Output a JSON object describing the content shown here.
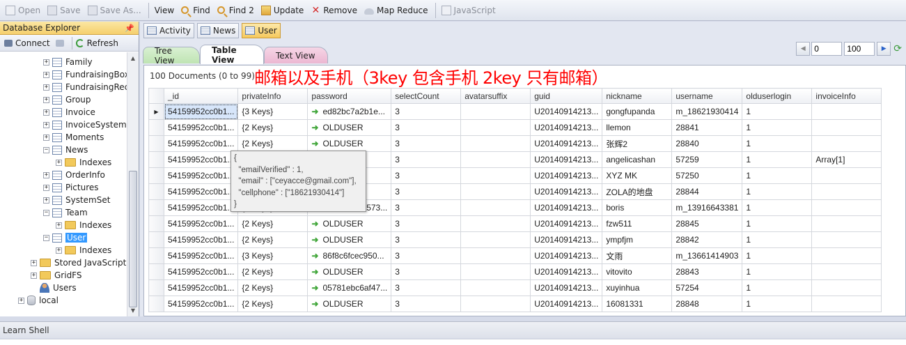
{
  "toolbar": {
    "open": "Open",
    "save": "Save",
    "save_as": "Save As...",
    "view": "View",
    "find": "Find",
    "find2": "Find 2",
    "update": "Update",
    "remove": "Remove",
    "map_reduce": "Map Reduce",
    "javascript": "JavaScript"
  },
  "explorer": {
    "title": "Database Explorer",
    "pin_icon": "pin-icon",
    "connect": "Connect",
    "refresh": "Refresh",
    "tree": [
      "Family",
      "FundraisingBox",
      "FundraisingRec",
      "Group",
      "Invoice",
      "InvoiceSystemS",
      "Moments",
      "News",
      "Indexes",
      "OrderInfo",
      "Pictures",
      "SystemSet",
      "Team",
      "Indexes",
      "User",
      "Indexes",
      "Stored JavaScript",
      "GridFS",
      "Users",
      "local"
    ]
  },
  "collection_tabs": [
    "Activity",
    "News",
    "User"
  ],
  "view_tabs": {
    "tree": "Tree View",
    "table": "Table View",
    "text": "Text View"
  },
  "pager": {
    "start": "0",
    "limit": "100"
  },
  "doc_count": "100 Documents (0 to 99)",
  "overlay_note": "邮箱以及手机（3key 包含手机 2key 只有邮箱）",
  "grid": {
    "columns": [
      "_id",
      "privateInfo",
      "password",
      "selectCount",
      "avatarsuffix",
      "guid",
      "nickname",
      "username",
      "olduserlogin",
      "invoiceInfo"
    ],
    "rows": [
      [
        "54159952cc0b1...",
        "{3 Keys}",
        "ed82bc7a2b1e...",
        "3",
        "",
        "U20140914213...",
        "gongfupanda",
        "m_18621930414",
        "1",
        ""
      ],
      [
        "54159952cc0b1...",
        "{2 Keys}",
        "OLDUSER",
        "3",
        "",
        "U20140914213...",
        "llemon",
        "28841",
        "1",
        ""
      ],
      [
        "54159952cc0b1...",
        "{2 Keys}",
        "OLDUSER",
        "3",
        "",
        "U20140914213...",
        "张辉2",
        "28840",
        "1",
        ""
      ],
      [
        "54159952cc0b1...",
        "{2 Keys}",
        "OLDUSER",
        "3",
        "",
        "U20140914213...",
        "angelicashan",
        "57259",
        "1",
        "Array[1]"
      ],
      [
        "54159952cc0b1...",
        "{2 Keys}",
        "OLDUSER",
        "3",
        "",
        "U20140914213...",
        "XYZ MK",
        "57250",
        "1",
        ""
      ],
      [
        "54159952cc0b1...",
        "{2 Keys}",
        "OLDUSER",
        "3",
        "",
        "U20140914213...",
        "ZOLA的地盘",
        "28844",
        "1",
        ""
      ],
      [
        "54159952cc0b1...",
        "{3 Keys}",
        "4ec7edafba573...",
        "3",
        "",
        "U20140914213...",
        "boris",
        "m_13916643381",
        "1",
        ""
      ],
      [
        "54159952cc0b1...",
        "{2 Keys}",
        "OLDUSER",
        "3",
        "",
        "U20140914213...",
        "fzw511",
        "28845",
        "1",
        ""
      ],
      [
        "54159952cc0b1...",
        "{2 Keys}",
        "OLDUSER",
        "3",
        "",
        "U20140914213...",
        "ympfjm",
        "28842",
        "1",
        ""
      ],
      [
        "54159952cc0b1...",
        "{3 Keys}",
        "86f8c6fcec950...",
        "3",
        "",
        "U20140914213...",
        "文雨",
        "m_13661414903",
        "1",
        ""
      ],
      [
        "54159952cc0b1...",
        "{2 Keys}",
        "OLDUSER",
        "3",
        "",
        "U20140914213...",
        "vitovito",
        "28843",
        "1",
        ""
      ],
      [
        "54159952cc0b1...",
        "{2 Keys}",
        "05781ebc6af47...",
        "3",
        "",
        "U20140914213...",
        "xuyinhua",
        "57254",
        "1",
        ""
      ],
      [
        "54159952cc0b1...",
        "{2 Keys}",
        "OLDUSER",
        "3",
        "",
        "U20140914213...",
        "16081331",
        "28848",
        "1",
        ""
      ]
    ]
  },
  "tooltip": {
    "lines": [
      "{",
      "  \"emailVerified\" : 1,",
      "  \"email\" : [\"ceyacce@gmail.com\"],",
      "  \"cellphone\" : [\"18621930414\"]",
      "}"
    ]
  },
  "shell": {
    "label": "Learn Shell"
  }
}
